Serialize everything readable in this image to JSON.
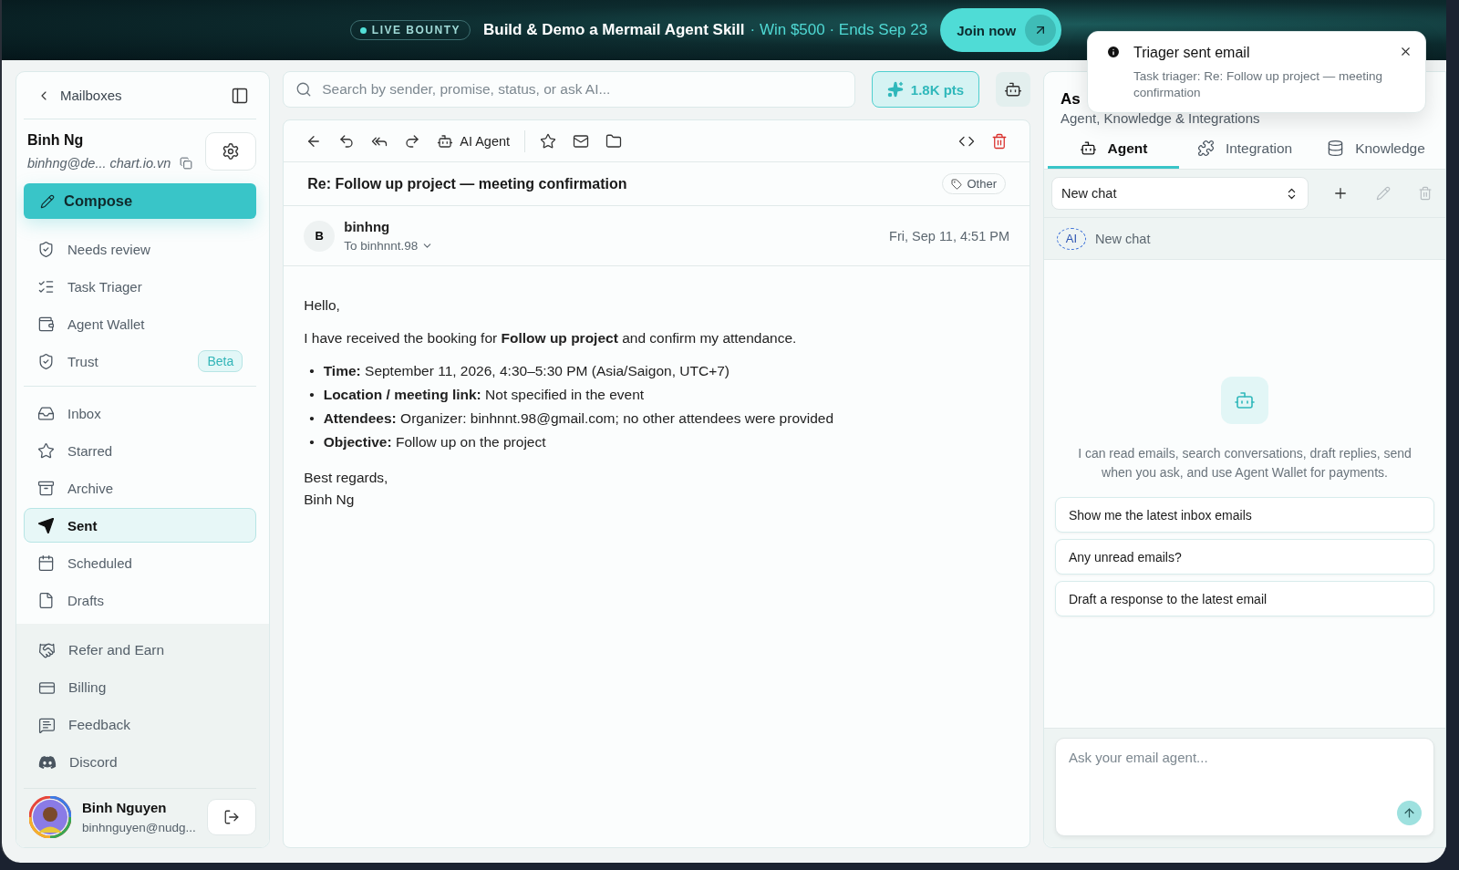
{
  "banner": {
    "badge": "LIVE BOUNTY",
    "title": "Build & Demo a Mermail Agent Skill",
    "highlight": "· Win $500 · Ends Sep 23",
    "button": "Join now"
  },
  "sidebar": {
    "back": "Mailboxes",
    "account": {
      "name": "Binh Ng",
      "email": "binhng@de... chart.io.vn"
    },
    "compose": "Compose",
    "groups": [
      {
        "items": [
          {
            "label": "Needs review",
            "selected": false
          },
          {
            "label": "Task Triager",
            "selected": false
          },
          {
            "label": "Agent Wallet",
            "selected": false
          },
          {
            "label": "Trust",
            "badge": "Beta",
            "selected": false
          }
        ]
      },
      {
        "items": [
          {
            "label": "Inbox",
            "selected": false
          },
          {
            "label": "Starred",
            "selected": false
          },
          {
            "label": "Archive",
            "selected": false
          },
          {
            "label": "Sent",
            "selected": true
          },
          {
            "label": "Scheduled",
            "selected": false
          },
          {
            "label": "Drafts",
            "selected": false
          }
        ]
      }
    ],
    "footer": [
      {
        "label": "Refer and Earn"
      },
      {
        "label": "Billing"
      },
      {
        "label": "Feedback"
      },
      {
        "label": "Discord"
      }
    ],
    "user": {
      "name": "Binh Nguyen",
      "email": "binhnguyen@nudg..."
    }
  },
  "search": {
    "placeholder": "Search by sender, promise, status, or ask AI..."
  },
  "points": "1.8K pts",
  "email": {
    "toolbar": {
      "agent": "AI Agent"
    },
    "subject": "Re: Follow up project — meeting confirmation",
    "tag": "Other",
    "sender": {
      "initial": "B",
      "name": "binhng",
      "to": "To binhnnt.98",
      "date": "Fri, Sep 11, 4:51 PM"
    },
    "greeting": "Hello,",
    "paragraph": "I have received the booking for **Follow up project** and confirm my attendance.",
    "bullets": [
      {
        "marker": "•",
        "text": "**Time:** September 11, 2026, 4:30–5:30 PM (Asia/Saigon, UTC+7)"
      },
      {
        "marker": "•",
        "text": "**Location / meeting link:** Not specified in the event"
      },
      {
        "marker": "•",
        "text": "**Attendees:** Organizer: binhnnt.98@gmail.com; no other attendees were provided"
      },
      {
        "marker": "•",
        "text": "**Objective:** Follow up on the project"
      }
    ],
    "closing": [
      "Best regards,",
      "Binh Ng"
    ]
  },
  "assistant": {
    "title": "As",
    "subtitle": "Agent, Knowledge & Integrations",
    "tabs": [
      {
        "label": "Agent",
        "selected": true
      },
      {
        "label": "Integration",
        "selected": false
      },
      {
        "label": "Knowledge",
        "selected": false
      }
    ],
    "chat_select": "New chat",
    "chat_item": {
      "badge": "AI",
      "label": "New chat"
    },
    "intro": "I can read emails, search conversations, draft replies, send when you ask, and use Agent Wallet for payments.",
    "suggestions": [
      "Show me the latest inbox emails",
      "Any unread emails?",
      "Draft a response to the latest email"
    ],
    "input": {
      "placeholder": "Ask your email agent..."
    }
  },
  "toast": {
    "title": "Triager sent email",
    "body": "Task triager: Re: Follow up project — meeting confirmation"
  }
}
